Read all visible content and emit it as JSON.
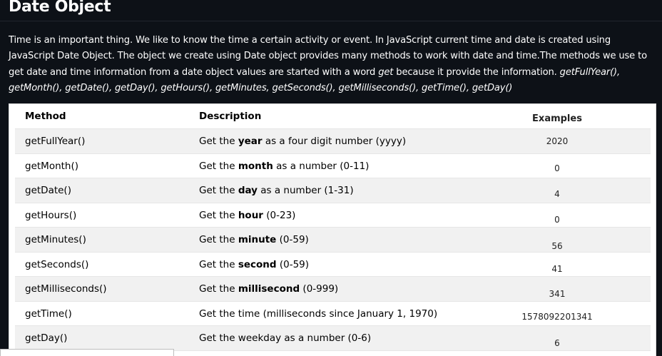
{
  "title": "Date Object",
  "intro": {
    "text": "Time is an important thing. We like to know the time a certain activity or event. In JavaScript current time and date is created using JavaScript Date Object. The object we create using Date object provides many methods to work with date and time.The methods we use to get date and time information from a date object values are started with a word ",
    "em_word": "get",
    "text2": " because it provide the information. ",
    "em_list": "getFullYear(), getMonth(), getDate(), getDay(), getHours(), getMinutes, getSeconds(), getMilliseconds(), getTime(), getDay()"
  },
  "table": {
    "headers": {
      "method": "Method",
      "description": "Description",
      "examples": "Examples"
    },
    "rows": [
      {
        "method": "getFullYear()",
        "pre": "Get the ",
        "bold": "year",
        "post": " as a four digit number (yyyy)",
        "example": "2020"
      },
      {
        "method": "getMonth()",
        "pre": "Get the ",
        "bold": "month",
        "post": " as a number (0-11)",
        "example": "0"
      },
      {
        "method": "getDate()",
        "pre": "Get the ",
        "bold": "day",
        "post": " as a number (1-31)",
        "example": "4"
      },
      {
        "method": "getHours()",
        "pre": "Get the ",
        "bold": "hour",
        "post": " (0-23)",
        "example": "0"
      },
      {
        "method": "getMinutes()",
        "pre": "Get the ",
        "bold": "minute",
        "post": " (0-59)",
        "example": "56"
      },
      {
        "method": "getSeconds()",
        "pre": "Get the ",
        "bold": "second",
        "post": " (0-59)",
        "example": "41"
      },
      {
        "method": "getMilliseconds()",
        "pre": "Get the ",
        "bold": "millisecond",
        "post": " (0-999)",
        "example": "341"
      },
      {
        "method": "getTime()",
        "pre": "Get the time (milliseconds since January 1, 1970)",
        "bold": "",
        "post": "",
        "example": "1578092201341"
      },
      {
        "method": "getDay()",
        "pre": "Get the weekday as a number (0-6)",
        "bold": "",
        "post": "",
        "example": "6"
      }
    ]
  }
}
